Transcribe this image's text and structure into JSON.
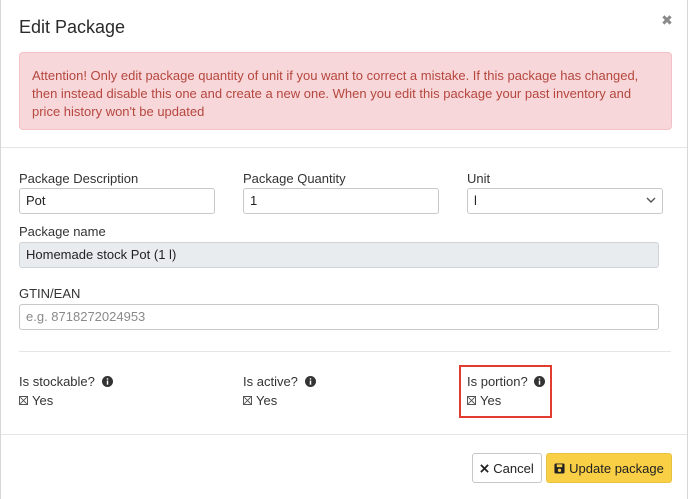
{
  "modal": {
    "title": "Edit Package",
    "close_icon": "close-icon",
    "alert": "Attention! Only edit package quantity of unit if you want to correct a mistake. If this package has changed, then instead disable this one and create a new one. When you edit this package your past inventory and price history won't be updated"
  },
  "form": {
    "description": {
      "label": "Package Description",
      "value": "Pot"
    },
    "quantity": {
      "label": "Package Quantity",
      "value": "1"
    },
    "unit": {
      "label": "Unit",
      "value": "l"
    },
    "package_name": {
      "label": "Package name",
      "value": "Homemade stock Pot (1 l)"
    },
    "gtin": {
      "label": "GTIN/EAN",
      "value": "",
      "placeholder": "e.g. 8718272024953"
    }
  },
  "options": {
    "stockable": {
      "label": "Is stockable?",
      "value": "Yes"
    },
    "active": {
      "label": "Is active?",
      "value": "Yes"
    },
    "portion": {
      "label": "Is portion?",
      "value": "Yes"
    }
  },
  "footer": {
    "cancel_label": "Cancel",
    "update_label": "Update package"
  },
  "colors": {
    "alert_bg": "#f8d7da",
    "alert_text": "#b5473e",
    "primary_button": "#f9cf45",
    "highlight": "#e23b2f"
  }
}
